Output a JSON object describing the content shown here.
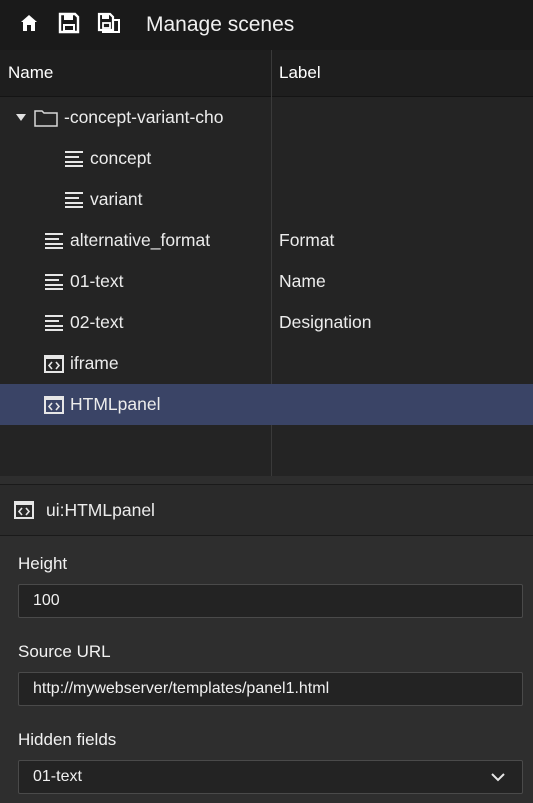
{
  "toolbar": {
    "icons": [
      "home-icon",
      "save-icon",
      "save-as-icon"
    ],
    "title": "Manage scenes"
  },
  "tree": {
    "columns": {
      "name": "Name",
      "label": "Label"
    },
    "rows": [
      {
        "name": "-concept-variant-cho",
        "label": "",
        "icon": "folder-icon",
        "expanded": true,
        "level": 0
      },
      {
        "name": "concept",
        "label": "",
        "icon": "text-lines-icon",
        "level": 1
      },
      {
        "name": "variant",
        "label": "",
        "icon": "text-lines-icon",
        "level": 1
      },
      {
        "name": "alternative_format",
        "label": "Format",
        "icon": "text-lines-icon",
        "level": 0
      },
      {
        "name": "01-text",
        "label": "Name",
        "icon": "text-lines-icon",
        "level": 0
      },
      {
        "name": "02-text",
        "label": "Designation",
        "icon": "text-lines-icon",
        "level": 0
      },
      {
        "name": "iframe",
        "label": "",
        "icon": "code-box-icon",
        "level": 0
      },
      {
        "name": "HTMLpanel",
        "label": "",
        "icon": "code-box-icon",
        "level": 0,
        "selected": true
      }
    ]
  },
  "panel": {
    "icon": "code-box-icon",
    "title": "ui:HTMLpanel",
    "height_label": "Height",
    "height_value": "100",
    "source_label": "Source URL",
    "source_value": "http://mywebserver/templates/panel1.html",
    "hidden_label": "Hidden fields",
    "hidden_value": "01-text"
  },
  "colors": {
    "selection": "#3a4466",
    "toolbar_bg": "#1a1a1a",
    "tree_bg": "#242424"
  }
}
